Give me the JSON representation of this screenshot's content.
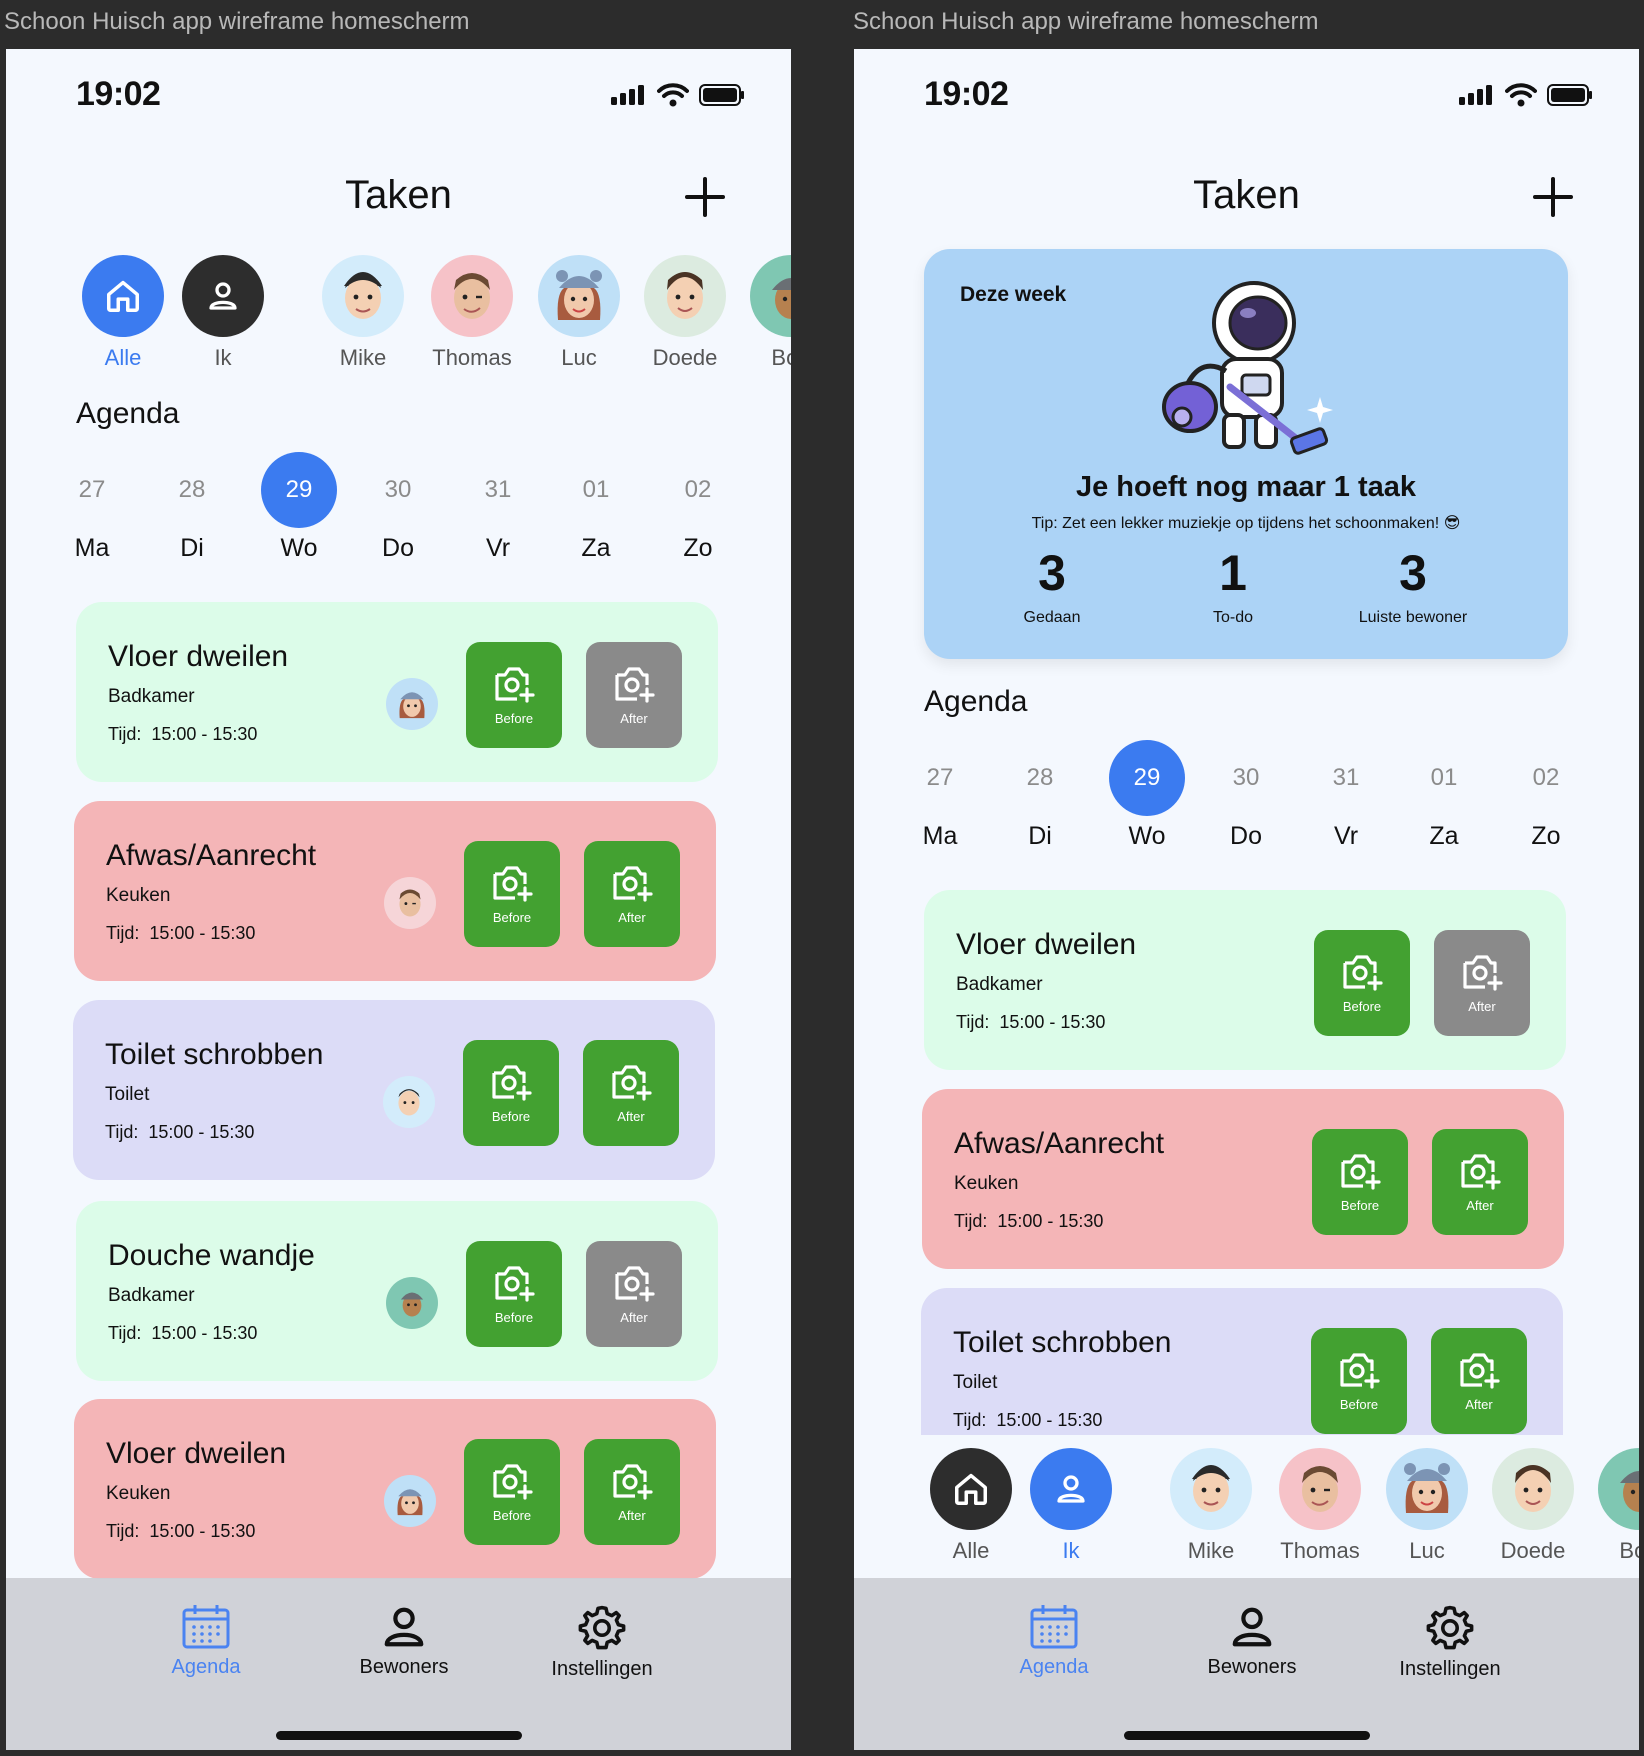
{
  "frames": [
    {
      "label": "Schoon Huisch app wireframe homescherm"
    },
    {
      "label": "Schoon Huisch app wireframe homescherm"
    }
  ],
  "status": {
    "time": "19:02"
  },
  "header": {
    "title": "Taken"
  },
  "filters": [
    {
      "label": "Alle",
      "icon": "home-icon"
    },
    {
      "label": "Ik",
      "icon": "person-icon"
    },
    {
      "label": "Mike"
    },
    {
      "label": "Thomas"
    },
    {
      "label": "Luc"
    },
    {
      "label": "Doede"
    },
    {
      "label": "Bob"
    }
  ],
  "agenda": {
    "title": "Agenda",
    "days": [
      {
        "num": "27",
        "name": "Ma"
      },
      {
        "num": "28",
        "name": "Di"
      },
      {
        "num": "29",
        "name": "Wo",
        "selected": true
      },
      {
        "num": "30",
        "name": "Do"
      },
      {
        "num": "31",
        "name": "Vr"
      },
      {
        "num": "01",
        "name": "Za"
      },
      {
        "num": "02",
        "name": "Zo"
      }
    ]
  },
  "photo_labels": {
    "before": "Before",
    "after": "After"
  },
  "tasks": [
    {
      "title": "Vloer dweilen",
      "room": "Badkamer",
      "time_label": "Tijd:",
      "time": "15:00 - 15:30",
      "color": "#dcfce9",
      "assignee": "Luc",
      "before_done": true,
      "after_done": false
    },
    {
      "title": "Afwas/Aanrecht",
      "room": "Keuken",
      "time_label": "Tijd:",
      "time": "15:00 - 15:30",
      "color": "#f4b5b7",
      "assignee": "Thomas",
      "before_done": true,
      "after_done": true
    },
    {
      "title": "Toilet schrobben",
      "room": "Toilet",
      "time_label": "Tijd:",
      "time": "15:00 - 15:30",
      "color": "#dcdcf7",
      "assignee": "Mike",
      "before_done": true,
      "after_done": true
    },
    {
      "title": "Douche wandje",
      "room": "Badkamer",
      "time_label": "Tijd:",
      "time": "15:00 - 15:30",
      "color": "#dcfce9",
      "assignee": "Bob",
      "before_done": true,
      "after_done": false
    },
    {
      "title": "Vloer dweilen",
      "room": "Keuken",
      "time_label": "Tijd:",
      "time": "15:00 - 15:30",
      "color": "#f4b5b7",
      "assignee": "Luc",
      "before_done": true,
      "after_done": true
    }
  ],
  "summary": {
    "week": "Deze week",
    "headline": "Je hoeft nog maar 1 taak",
    "tip": "Tip: Zet een lekker muziekje op tijdens het schoonmaken! 😎",
    "stats": [
      {
        "value": "3",
        "label": "Gedaan"
      },
      {
        "value": "1",
        "label": "To-do"
      },
      {
        "value": "3",
        "label": "Luiste bewoner"
      }
    ]
  },
  "tabbar": {
    "items": [
      {
        "label": "Agenda",
        "icon": "calendar-icon",
        "active": true
      },
      {
        "label": "Bewoners",
        "icon": "person-icon"
      },
      {
        "label": "Instellingen",
        "icon": "gear-icon"
      }
    ]
  },
  "colors": {
    "accent": "#3b7bf0",
    "done": "#43a131",
    "pending": "#8a8a8a",
    "dark": "#2d2d2d"
  }
}
